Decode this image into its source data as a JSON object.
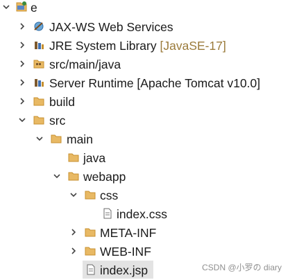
{
  "tree": {
    "items": [
      {
        "label": "e",
        "toggle": "expanded"
      },
      {
        "label": "JAX-WS Web Services",
        "toggle": "collapsed"
      },
      {
        "label": "JRE System Library",
        "decoration": "[JavaSE-17]",
        "toggle": "collapsed"
      },
      {
        "label": "src/main/java",
        "toggle": "collapsed"
      },
      {
        "label": "Server Runtime [Apache Tomcat v10.0]",
        "toggle": "collapsed"
      },
      {
        "label": "build",
        "toggle": "collapsed"
      },
      {
        "label": "src",
        "toggle": "expanded"
      },
      {
        "label": "main",
        "toggle": "expanded"
      },
      {
        "label": "java",
        "toggle": "none"
      },
      {
        "label": "webapp",
        "toggle": "expanded"
      },
      {
        "label": "css",
        "toggle": "expanded"
      },
      {
        "label": "index.css",
        "toggle": "none"
      },
      {
        "label": "META-INF",
        "toggle": "collapsed"
      },
      {
        "label": "WEB-INF",
        "toggle": "collapsed"
      },
      {
        "label": "index.jsp",
        "toggle": "none",
        "selected": true
      }
    ]
  },
  "icons": {
    "project": "project-icon",
    "webservices": "jaxws-icon",
    "library": "library-icon",
    "source": "package-folder-icon",
    "folder": "folder-icon",
    "file": "file-icon"
  },
  "colors": {
    "folder": "#e8b964",
    "folder_dark": "#c7902f",
    "selection": "#e3e3e3",
    "decoration": "#9b7b3b"
  },
  "watermark": "CSDN @小罗の diary"
}
